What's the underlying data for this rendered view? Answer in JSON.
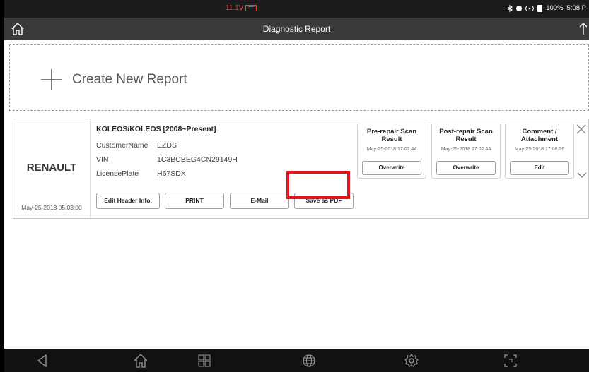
{
  "status_bar": {
    "voltage": "11.1V",
    "battery_percent": "100%",
    "time": "5:08 P"
  },
  "header": {
    "title": "Diagnostic Report"
  },
  "create_report": {
    "label": "Create New Report"
  },
  "report": {
    "brand": "RENAULT",
    "date": "May-25-2018 05:03:00",
    "model": "KOLEOS/KOLEOS [2008~Present]",
    "fields": [
      {
        "key": "CustomerName",
        "value": "EZDS"
      },
      {
        "key": "VIN",
        "value": "1C3BCBEG4CN29149H"
      },
      {
        "key": "LicensePlate",
        "value": "H67SDX"
      }
    ],
    "buttons": {
      "edit_header": "Edit Header Info.",
      "print": "PRINT",
      "email": "E-Mail",
      "save_pdf": "Save as PDF"
    },
    "scan_boxes": [
      {
        "title_line1": "Pre-repair Scan",
        "title_line2": "Result",
        "date": "May-25-2018 17:02:44",
        "action": "Overwrite"
      },
      {
        "title_line1": "Post-repair Scan",
        "title_line2": "Result",
        "date": "May-25-2018 17:02:44",
        "action": "Overwrite"
      },
      {
        "title_line1": "Comment /",
        "title_line2": "Attachment",
        "date": "May-25-2018 17:08:26",
        "action": "Edit"
      }
    ]
  },
  "colors": {
    "highlight": "#e8121b",
    "header_bg": "#3a3a3a",
    "voltage": "#ff3b30"
  },
  "icons": [
    "home-icon",
    "upload-icon",
    "plus-icon",
    "close-icon",
    "chevron-down-icon",
    "back-icon",
    "home-nav-icon",
    "recent-apps-icon",
    "globe-icon",
    "settings-icon",
    "screenshot-icon"
  ]
}
